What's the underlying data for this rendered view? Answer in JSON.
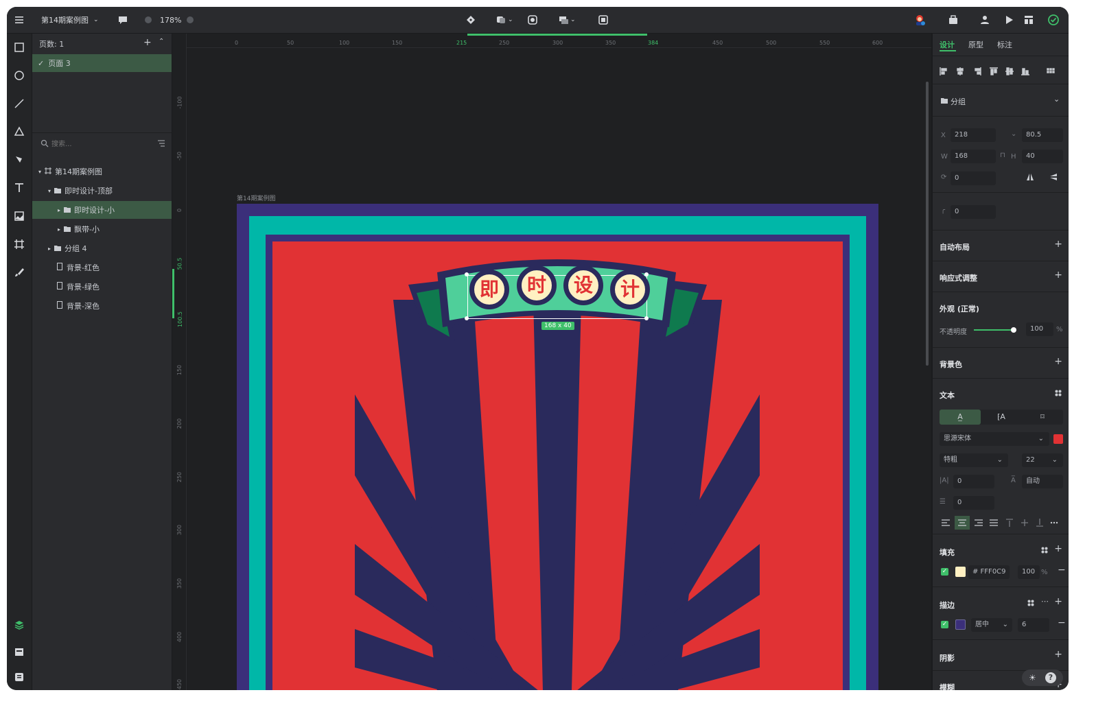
{
  "topbar": {
    "file_title": "第14期案例图",
    "zoom": "178%"
  },
  "layers": {
    "page_label": "页数: 1",
    "page_item": "页面 3",
    "search_placeholder": "搜索...",
    "tree": [
      {
        "label": "第14期案例图"
      },
      {
        "label": "即时设计-顶部"
      },
      {
        "label": "即时设计-小"
      },
      {
        "label": "飘带-小"
      },
      {
        "label": "分组 4"
      },
      {
        "label": "背景-红色"
      },
      {
        "label": "背景-绿色"
      },
      {
        "label": "背景-深色"
      }
    ]
  },
  "canvas": {
    "frame_label": "第14期案例图",
    "selection_size": "168 x 40",
    "ruler_h": [
      "0",
      "50",
      "100",
      "150",
      "215",
      "250",
      "300",
      "350",
      "384",
      "450",
      "500",
      "550",
      "600"
    ],
    "ruler_v": [
      "-100",
      "-50",
      "0",
      "50.5",
      "100.5",
      "150",
      "200",
      "250",
      "300",
      "350",
      "400",
      "450"
    ],
    "artwork_chars": [
      "即",
      "时",
      "设",
      "计"
    ],
    "colors": {
      "purple": "#3b2f7a",
      "teal": "#00b7a8",
      "red": "#e13234",
      "navy": "#2a2a5c",
      "green": "#4fcf9a",
      "dark_green": "#0f7a4e",
      "cream": "#fff0c2"
    }
  },
  "right": {
    "tabs": [
      "设计",
      "原型",
      "标注"
    ],
    "group_name": "分组",
    "x": "218",
    "y": "80.5",
    "w": "168",
    "h": "40",
    "rotation": "0",
    "radius": "0",
    "auto_layout": "自动布局",
    "responsive": "响应式调整",
    "appearance": "外观 (正常)",
    "opacity_label": "不透明度",
    "opacity_value": "100",
    "opacity_level": 1.0,
    "bg_color": "背景色",
    "text_section": "文本",
    "font_family": "思源宋体",
    "font_weight": "特粗",
    "font_size": "22",
    "letter_spacing": "0",
    "line_height": "自动",
    "para_spacing": "0",
    "fill_label": "填充",
    "fill_hex": "# FFF0C9",
    "fill_opacity": "100",
    "stroke_label": "描边",
    "stroke_position": "居中",
    "stroke_width": "6",
    "shadow_label": "阴影",
    "blur_label": "模糊",
    "percent": "%"
  }
}
